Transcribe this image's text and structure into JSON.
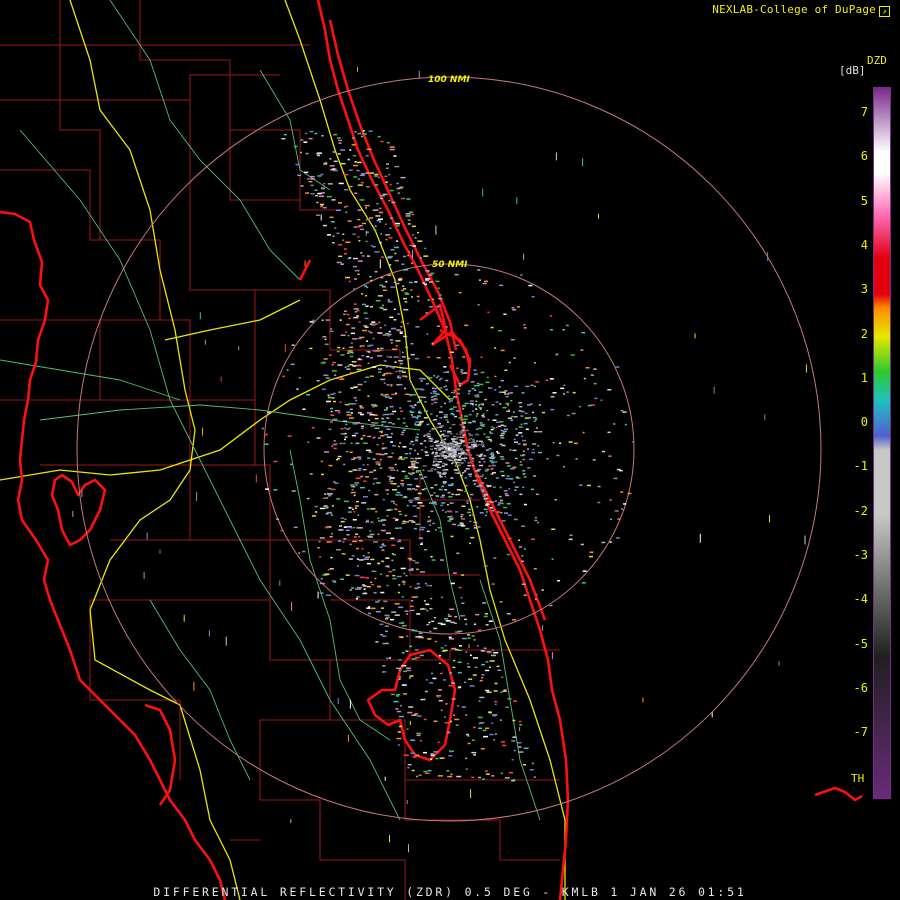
{
  "header": {
    "credit": "NEXLAB-College of DuPage"
  },
  "footer": {
    "caption": "DIFFERENTIAL REFLECTIVITY (ZDR) 0.5 DEG - KMLB 1 JAN 26 01:51"
  },
  "legend": {
    "product": "DZD",
    "unit": "[dB]",
    "ticks": [
      "7",
      "6",
      "5",
      "4",
      "3",
      "2",
      "1",
      "0",
      "-1",
      "-2",
      "-3",
      "-4",
      "-5",
      "-6",
      "-7"
    ],
    "threshold_label": "TH",
    "colors": {
      "top": "#7a2a8a",
      "light": "#ffffff",
      "pink": "#ff69b4",
      "red": "#e00010",
      "orange": "#ff8c00",
      "yellow": "#e8e800",
      "green": "#2ec82e",
      "cyan": "#20c0c0",
      "blue": "#5060d0",
      "gray": "#c8c8c8",
      "dark": "#202020",
      "bottom": "#6a2a7a"
    }
  },
  "range_rings": [
    {
      "label": "50 NMI",
      "range_nmi": 50
    },
    {
      "label": "100 NMI",
      "range_nmi": 100
    }
  ],
  "map_colors": {
    "coastline": "#ff1010",
    "county": "#a01818",
    "highway": "#e8e800",
    "road": "#50c070",
    "ring": "#c87878"
  }
}
